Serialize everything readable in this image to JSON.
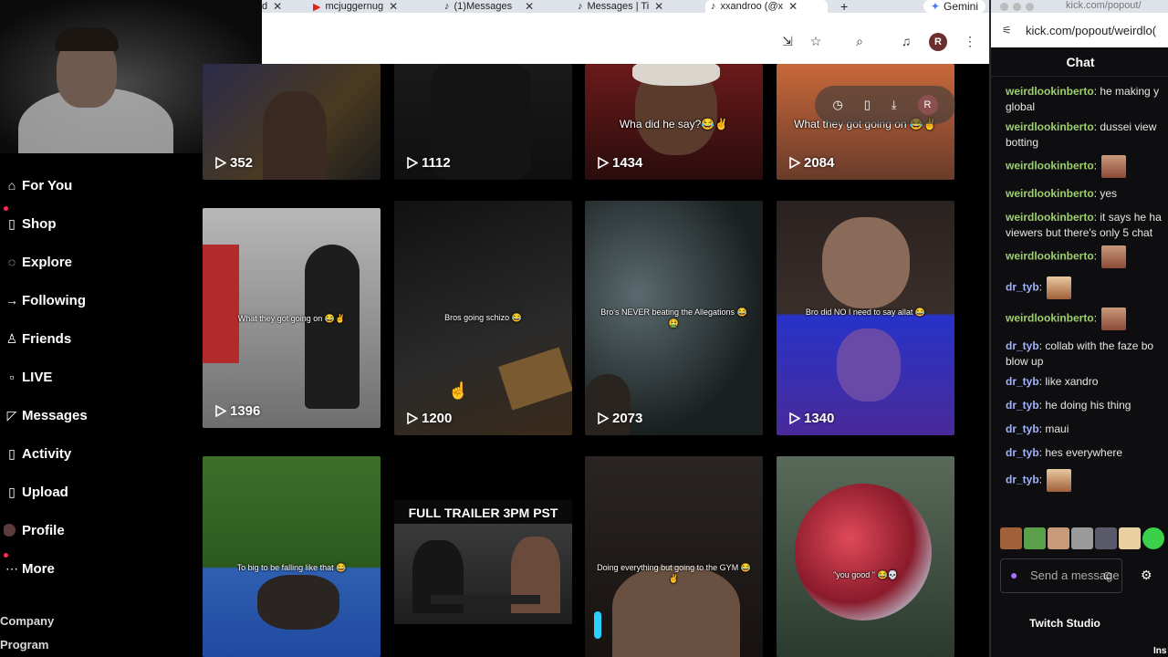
{
  "browser": {
    "tabs": [
      {
        "label": "d",
        "icon": "none"
      },
      {
        "label": "mcjuggernug",
        "icon": "youtube-icon"
      },
      {
        "label": "(1)Messages",
        "icon": "tiktok-icon"
      },
      {
        "label": "Messages | Ti",
        "icon": "tiktok-icon"
      },
      {
        "label": "xxandroo (@x",
        "icon": "tiktok-icon",
        "active": true
      }
    ],
    "new_tab": "+",
    "gemini_label": "Gemini",
    "profile_initial": "R"
  },
  "sidebar": {
    "items": [
      {
        "label": "For You",
        "icon": "home-icon"
      },
      {
        "label": "Shop",
        "icon": "shop-icon"
      },
      {
        "label": "Explore",
        "icon": "compass-icon"
      },
      {
        "label": "Following",
        "icon": "following-icon"
      },
      {
        "label": "Friends",
        "icon": "friends-icon"
      },
      {
        "label": "LIVE",
        "icon": "live-icon"
      },
      {
        "label": "Messages",
        "icon": "messages-icon"
      },
      {
        "label": "Activity",
        "icon": "activity-icon"
      },
      {
        "label": "Upload",
        "icon": "upload-icon"
      },
      {
        "label": "Profile",
        "icon": "profile-icon"
      },
      {
        "label": "More",
        "icon": "more-icon"
      }
    ],
    "footer": [
      "Company",
      "Program"
    ]
  },
  "video_overlay": {
    "profile_initial": "R"
  },
  "videos": {
    "row1": [
      {
        "views": "352",
        "caption": ""
      },
      {
        "views": "1112",
        "caption": ""
      },
      {
        "views": "1434",
        "caption": "Wha did he say?😂✌️"
      },
      {
        "views": "2084",
        "caption": "What they got going on 😂✌️"
      }
    ],
    "row2": [
      {
        "views": "1396",
        "caption": "What they got going on 😂✌️"
      },
      {
        "views": "1200",
        "caption": "Bros going schizo 😂"
      },
      {
        "views": "2073",
        "caption": "Bro's NEVER beating the Allegations 😂🤮"
      },
      {
        "views": "1340",
        "caption": "Bro did NO I need to say allat 😂"
      }
    ],
    "row3": [
      {
        "caption": "To big to be falling like that 😂"
      },
      {
        "caption": "FULL TRAILER 3PM PST"
      },
      {
        "caption": "Doing everything but going to the GYM 😂✌️"
      },
      {
        "caption": "\"you good \" 😂💀"
      }
    ]
  },
  "chat": {
    "window_title": "kick.com/popout/",
    "url": "kick.com/popout/weirdlo(",
    "title": "Chat",
    "messages": [
      {
        "user": "weirdlookinberto",
        "text": " he making y global",
        "emote": false
      },
      {
        "user": "weirdlookinberto",
        "text": " dussei view botting",
        "emote": false
      },
      {
        "user": "weirdlookinberto",
        "text": "",
        "emote": true
      },
      {
        "user": "weirdlookinberto",
        "text": " yes",
        "emote": false
      },
      {
        "user": "weirdlookinberto",
        "text": " it says he ha viewers but there's only 5 chat",
        "emote": false
      },
      {
        "user": "weirdlookinberto",
        "text": "",
        "emote": true
      },
      {
        "user": "dr_tyb",
        "text": "",
        "emote": true
      },
      {
        "user": "weirdlookinberto",
        "text": "",
        "emote": true
      },
      {
        "user": "dr_tyb",
        "text": " collab with the faze bo blow up",
        "emote": false
      },
      {
        "user": "dr_tyb",
        "text": " like xandro",
        "emote": false
      },
      {
        "user": "dr_tyb",
        "text": " he doing his thing",
        "emote": false
      },
      {
        "user": "dr_tyb",
        "text": " maui",
        "emote": false
      },
      {
        "user": "dr_tyb",
        "text": " hes everywhere",
        "emote": false
      },
      {
        "user": "dr_tyb",
        "text": "",
        "emote": true
      }
    ],
    "input_placeholder": "Send a message",
    "studio_label": "Twitch Studio",
    "corner_text": "Ins"
  },
  "colors": {
    "username_a": "#9dd06b",
    "username_b": "#9fb3ff",
    "accent": "#fe2c55",
    "mic": "#a970ff"
  }
}
